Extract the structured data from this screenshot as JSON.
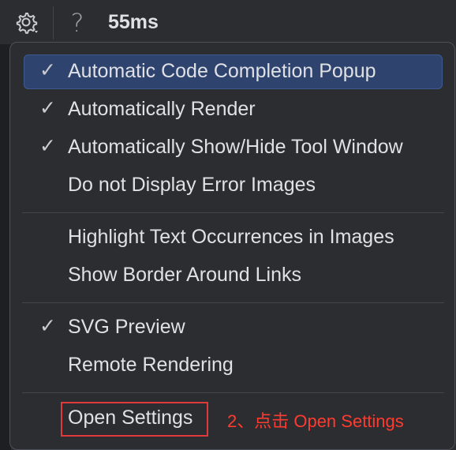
{
  "toolbar": {
    "gear_icon": "gear-icon",
    "help_label": "?",
    "render_time": "55ms"
  },
  "menu": {
    "items": [
      {
        "label": "Automatic Code Completion Popup",
        "checked": true,
        "selected": true
      },
      {
        "label": "Automatically Render",
        "checked": true,
        "selected": false
      },
      {
        "label": "Automatically Show/Hide Tool Window",
        "checked": true,
        "selected": false
      },
      {
        "label": "Do not Display Error Images",
        "checked": false,
        "selected": false
      },
      {
        "label": "Highlight Text Occurrences in Images",
        "checked": false,
        "selected": false
      },
      {
        "label": "Show Border Around Links",
        "checked": false,
        "selected": false
      },
      {
        "label": "SVG Preview",
        "checked": true,
        "selected": false
      },
      {
        "label": "Remote Rendering",
        "checked": false,
        "selected": false
      },
      {
        "label": "Open Settings",
        "checked": false,
        "selected": false
      }
    ],
    "check_glyph": "✓"
  },
  "annotation": {
    "text": "2、点击 Open Settings",
    "color": "#ff3b30"
  },
  "colors": {
    "selected_bg": "#2e436e",
    "popup_bg": "#2b2d30",
    "highlight_border": "#e03a3a"
  }
}
